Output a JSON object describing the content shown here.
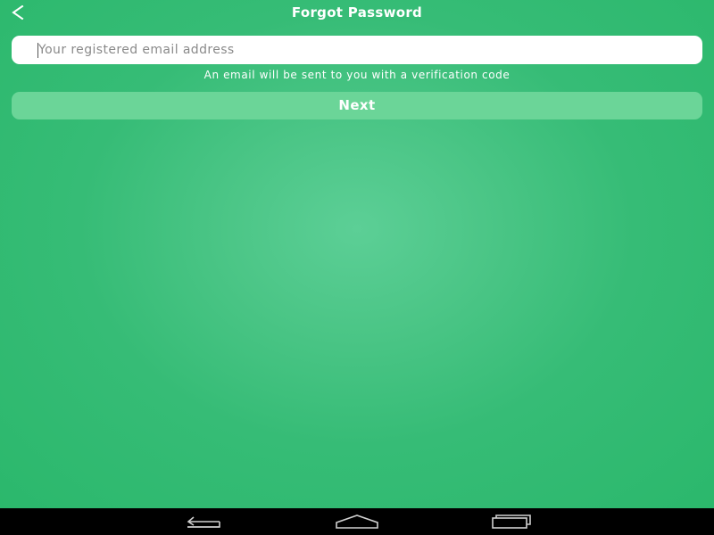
{
  "header": {
    "back_icon": "chevron-left-icon",
    "title": "Forgot Password"
  },
  "form": {
    "email_value": "",
    "email_placeholder": "Your registered email address",
    "hint": "An email will be sent to you with a verification code",
    "next_label": "Next"
  },
  "navbar": {
    "back_icon": "back-arrow-icon",
    "home_icon": "home-icon",
    "recents_icon": "recent-apps-icon"
  },
  "colors": {
    "background": "#2bb86c",
    "background_center": "#5ccf96",
    "button": "#6bd598",
    "navbar": "#000000"
  }
}
